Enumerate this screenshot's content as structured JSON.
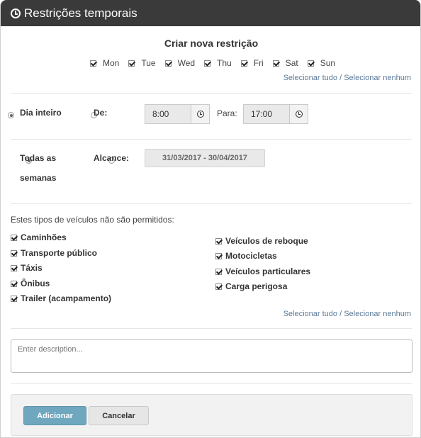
{
  "window": {
    "title": "Restrições temporais",
    "icon": "clock-icon"
  },
  "heading": "Criar nova restrição",
  "days": [
    {
      "label": "Mon",
      "checked": true
    },
    {
      "label": "Tue",
      "checked": true
    },
    {
      "label": "Wed",
      "checked": true
    },
    {
      "label": "Thu",
      "checked": true
    },
    {
      "label": "Fri",
      "checked": true
    },
    {
      "label": "Sat",
      "checked": true
    },
    {
      "label": "Sun",
      "checked": true
    }
  ],
  "select_all": "Selecionar tudo",
  "separator": "/",
  "select_none": "Selecionar nenhum",
  "time": {
    "all_day_label": "Dia inteiro",
    "from_label": "De:",
    "from_value": "8:00",
    "to_label": "Para:",
    "to_value": "17:00",
    "selected": "all_day"
  },
  "weeks": {
    "all_weeks_label_line1": "Todas as",
    "all_weeks_label_line2": "semanas",
    "range_label": "Alcance:",
    "range_value": "31/03/2017 - 30/04/2017",
    "selected": "all_weeks"
  },
  "vehicles": {
    "intro": "Estes tipos de veículos não são permitidos:",
    "left": [
      {
        "label": "Caminhões",
        "checked": true
      },
      {
        "label": "Transporte público",
        "checked": true
      },
      {
        "label": "Táxis",
        "checked": true
      },
      {
        "label": "Ônibus",
        "checked": true
      },
      {
        "label": "Trailer (acampamento)",
        "checked": true
      }
    ],
    "right": [
      {
        "label": "Veículos de reboque",
        "checked": true
      },
      {
        "label": "Motocicletas",
        "checked": true
      },
      {
        "label": "Veículos particulares",
        "checked": true
      },
      {
        "label": "Carga perigosa",
        "checked": true
      }
    ]
  },
  "description": {
    "placeholder": "Enter description...",
    "value": ""
  },
  "buttons": {
    "add": "Adicionar",
    "cancel": "Cancelar"
  },
  "colors": {
    "titlebar": "#3a3a3a",
    "add_button": "#6fa7bf",
    "link": "#5b7a99"
  }
}
